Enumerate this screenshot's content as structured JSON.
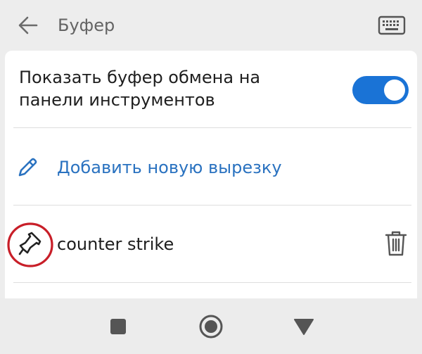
{
  "header": {
    "title": "Буфер",
    "back_icon": "arrow-left-icon",
    "keyboard_icon": "keyboard-icon"
  },
  "settings": {
    "show_clipboard_label": "Показать буфер обмена на панели инструментов",
    "show_clipboard_enabled": true
  },
  "add_clip": {
    "label": "Добавить новую вырезку",
    "icon": "pencil-icon"
  },
  "clips": [
    {
      "text": "counter strike",
      "pin_icon": "pin-icon",
      "delete_icon": "trash-icon"
    }
  ],
  "navbar": {
    "items": [
      "square-icon",
      "circle-icon",
      "triangle-down-icon"
    ]
  },
  "colors": {
    "accent": "#1a73d6",
    "link": "#2a72c0",
    "annotation": "#c81e28"
  }
}
